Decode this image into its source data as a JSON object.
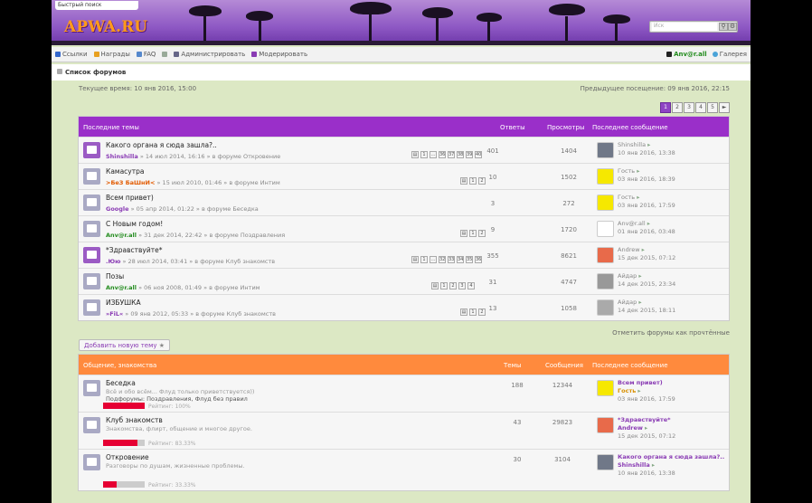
{
  "header": {
    "quick_search": "Быстрый поиск",
    "logo": "APWA.RU",
    "search_placeholder": "Иск"
  },
  "navbar": {
    "left": [
      "Ссылки",
      "Награды",
      "FAQ",
      "Администрировать",
      "Модерировать"
    ],
    "user": "Anv@r.all",
    "gallery": "Галерея"
  },
  "breadcrumb": "Список форумов",
  "info": {
    "current_time": "Текущее время: 10 янв 2016, 15:00",
    "prev_visit": "Предыдущее посещение: 09 янв 2016, 22:15"
  },
  "pagination": [
    "1",
    "2",
    "3",
    "4",
    "5"
  ],
  "recent": {
    "headers": {
      "title": "Последние темы",
      "replies": "Ответы",
      "views": "Просмотры",
      "last": "Последнее сообщение"
    },
    "rows": [
      {
        "title": "Какого органа я сюда зашла?..",
        "author": "Shinshilla",
        "meta": "» 14 июл 2014, 16:16 » в форуме Откровение",
        "replies": "401",
        "views": "1404",
        "last_user": "Shinshilla",
        "last_date": "10 янв 2016, 13:38",
        "pages": [
          "1",
          "…",
          "36",
          "37",
          "38",
          "39",
          "40"
        ]
      },
      {
        "title": "Камасутра",
        "author": ">БеЗ БаШнИ<",
        "meta": "» 15 июл 2010, 01:46 » в форуме Интим",
        "replies": "10",
        "views": "1502",
        "last_user": "Гость",
        "last_date": "03 янв 2016, 18:39",
        "pages": [
          "1",
          "2"
        ]
      },
      {
        "title": "Всем привет)",
        "author": "Google",
        "meta": "» 05 апр 2014, 01:22 » в форуме Беседка",
        "replies": "3",
        "views": "272",
        "last_user": "Гость",
        "last_date": "03 янв 2016, 17:59",
        "pages": []
      },
      {
        "title": "С Новым годом!",
        "author": "Anv@r.all",
        "meta": "» 31 дек 2014, 22:42 » в форуме Поздравления",
        "replies": "9",
        "views": "1720",
        "last_user": "Anv@r.all",
        "last_date": "01 янв 2016, 03:48",
        "pages": [
          "1",
          "2"
        ]
      },
      {
        "title": "*Здравствуйте*",
        "author": ".Юю",
        "meta": "» 28 июл 2014, 03:41 » в форуме Клуб знакомств",
        "replies": "355",
        "views": "8621",
        "last_user": "Andrew",
        "last_date": "15 дек 2015, 07:12",
        "pages": [
          "1",
          "…",
          "32",
          "33",
          "34",
          "35",
          "36"
        ]
      },
      {
        "title": "Позы",
        "author": "Anv@r.all",
        "meta": "» 06 ноя 2008, 01:49 » в форуме Интим",
        "replies": "31",
        "views": "4747",
        "last_user": "Айдар",
        "last_date": "14 дек 2015, 23:34",
        "pages": [
          "1",
          "2",
          "3",
          "4"
        ]
      },
      {
        "title": "ИЗБУШКА",
        "author": "»FiL«",
        "meta": "» 09 янв 2012, 05:33 » в форуме Клуб знакомств",
        "replies": "13",
        "views": "1058",
        "last_user": "Айдар",
        "last_date": "14 дек 2015, 18:11",
        "pages": [
          "1",
          "2"
        ]
      }
    ]
  },
  "mark_read": "Отметить форумы как прочтённые",
  "new_topic": "Добавить новую тему",
  "forums": {
    "headers": {
      "title": "Общение, знакомства",
      "topics": "Темы",
      "posts": "Сообщения",
      "last": "Последнее сообщение"
    },
    "rows": [
      {
        "name": "Беседка",
        "desc": "Всё и обо всём... Флуд только приветствуется))",
        "sub": "Подфорумы: Поздравления, Флуд без правил",
        "topics": "188",
        "posts": "12344",
        "last_title": "Всем привет)",
        "last_user": "Гость",
        "last_date": "03 янв 2016, 17:59",
        "rating": "Рейтинг: 100%",
        "rating_value": 100
      },
      {
        "name": "Клуб знакомств",
        "desc": "Знакомства, флирт, общение и многое другое.",
        "sub": "",
        "topics": "43",
        "posts": "29823",
        "last_title": "*Здравствуйте*",
        "last_user": "Andrew",
        "last_date": "15 дек 2015, 07:12",
        "rating": "Рейтинг: 83.33%",
        "rating_value": 83.33
      },
      {
        "name": "Откровение",
        "desc": "Разговоры по душам, жизненные проблемы.",
        "sub": "",
        "topics": "30",
        "posts": "3104",
        "last_title": "Какого органа я сюда зашла?..",
        "last_user": "Shinshilla",
        "last_date": "10 янв 2016, 13:38",
        "rating": "Рейтинг: 33.33%",
        "rating_value": 33.33
      }
    ]
  },
  "colors": {
    "purple": "#9a2fc9",
    "orange": "#ff8a3d",
    "bg": "#dce8c4"
  }
}
